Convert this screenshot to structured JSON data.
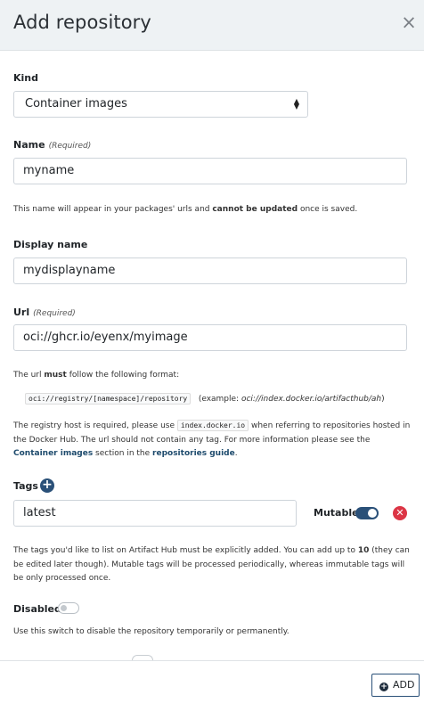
{
  "modal": {
    "title": "Add repository",
    "close_glyph": "×"
  },
  "kind": {
    "label": "Kind",
    "value": "Container images"
  },
  "name": {
    "label": "Name",
    "required": "(Required)",
    "value": "myname"
  },
  "name_help": {
    "pre": "This name will appear in your packages' urls and ",
    "bold": "cannot be updated",
    "post": " once is saved."
  },
  "display_name": {
    "label": "Display name",
    "value": "mydisplayname"
  },
  "url": {
    "label": "Url",
    "required": "(Required)",
    "value": "oci://ghcr.io/eyenx/myimage"
  },
  "url_help": {
    "pre": "The url ",
    "bold": "must",
    "post": " follow the following format:",
    "format_code": "oci://registry/[namespace]/repository",
    "example_pre": "(example: ",
    "example_value": "oci://index.docker.io/artifacthub/ah",
    "example_post": ")",
    "registry_pre": "The registry host is required, please use ",
    "registry_code": "index.docker.io",
    "registry_mid": " when referring to repositories hosted in the Docker Hub. The url should not contain any tag. For more information please see the ",
    "link_container_images": "Container images",
    "registry_mid2": " section in the ",
    "link_repositories_guide": "repositories guide",
    "registry_post": "."
  },
  "tags": {
    "label": "Tags",
    "add_icon": "plus-icon",
    "items": [
      {
        "value": "latest",
        "mutable_label": "Mutable",
        "mutable": true
      }
    ],
    "help_pre": "The tags you'd like to list on Artifact Hub must be explicitly added. You can add up to ",
    "help_bold": "10",
    "help_post": " (they can be edited later though). Mutable tags will be processed periodically, whereas immutable tags will be only processed once."
  },
  "disabled": {
    "label": "Disabled",
    "on": false,
    "help": "Use this switch to disable the repository temporarily or permanently."
  },
  "footer": {
    "add_label": "ADD"
  },
  "colors": {
    "accent": "#2a5078",
    "danger": "#dc3545",
    "header_bg": "#eef2f4"
  }
}
